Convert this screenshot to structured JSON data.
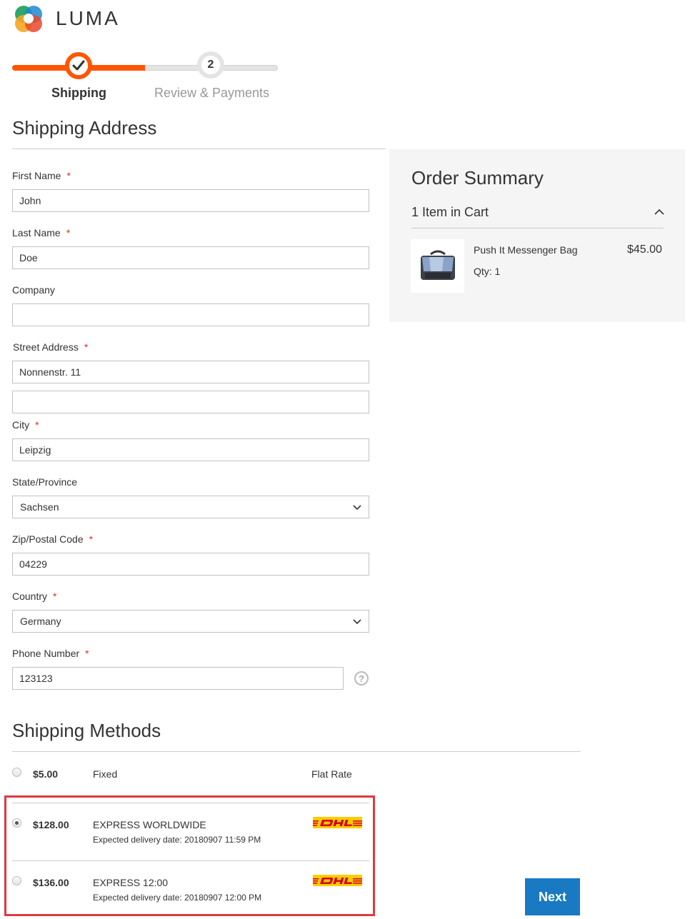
{
  "brand": {
    "name": "LUMA",
    "accent": "#ff5501",
    "primary": "#1979c3"
  },
  "progress": {
    "steps": [
      {
        "number": "1",
        "label": "Shipping",
        "state": "complete"
      },
      {
        "number": "2",
        "label": "Review & Payments",
        "state": "pending"
      }
    ]
  },
  "shipping_address": {
    "title": "Shipping Address",
    "required_marker": "*",
    "fields": {
      "first_name": {
        "label": "First Name",
        "value": "John",
        "required": true
      },
      "last_name": {
        "label": "Last Name",
        "value": "Doe",
        "required": true
      },
      "company": {
        "label": "Company",
        "value": "",
        "required": false
      },
      "street": {
        "label": "Street Address",
        "value": "Nonnenstr. 11",
        "value2": "",
        "required": true
      },
      "city": {
        "label": "City",
        "value": "Leipzig",
        "required": true
      },
      "state": {
        "label": "State/Province",
        "value": "Sachsen",
        "required": false
      },
      "zip": {
        "label": "Zip/Postal Code",
        "value": "04229",
        "required": true
      },
      "country": {
        "label": "Country",
        "value": "Germany",
        "required": true
      },
      "phone": {
        "label": "Phone Number",
        "value": "123123",
        "required": true,
        "help_icon": "question-icon"
      }
    }
  },
  "order_summary": {
    "title": "Order Summary",
    "items_count": "1 Item in Cart",
    "items": [
      {
        "name": "Push It Messenger Bag",
        "qty": "Qty: 1",
        "price": "$45.00",
        "image_icon": "messenger-bag"
      }
    ]
  },
  "shipping_methods": {
    "title": "Shipping Methods",
    "methods": [
      {
        "price": "$5.00",
        "title": "Fixed",
        "carrier": "Flat Rate",
        "selected": false
      },
      {
        "price": "$128.00",
        "title": "EXPRESS WORLDWIDE",
        "subtitle": "Expected delivery date: 20180907 11:59 PM",
        "carrier": "DHL",
        "selected": true
      },
      {
        "price": "$136.00",
        "title": "EXPRESS 12:00",
        "subtitle": "Expected delivery date: 20180907 12:00 PM",
        "carrier": "DHL",
        "selected": false
      }
    ]
  },
  "actions": {
    "next": "Next"
  }
}
